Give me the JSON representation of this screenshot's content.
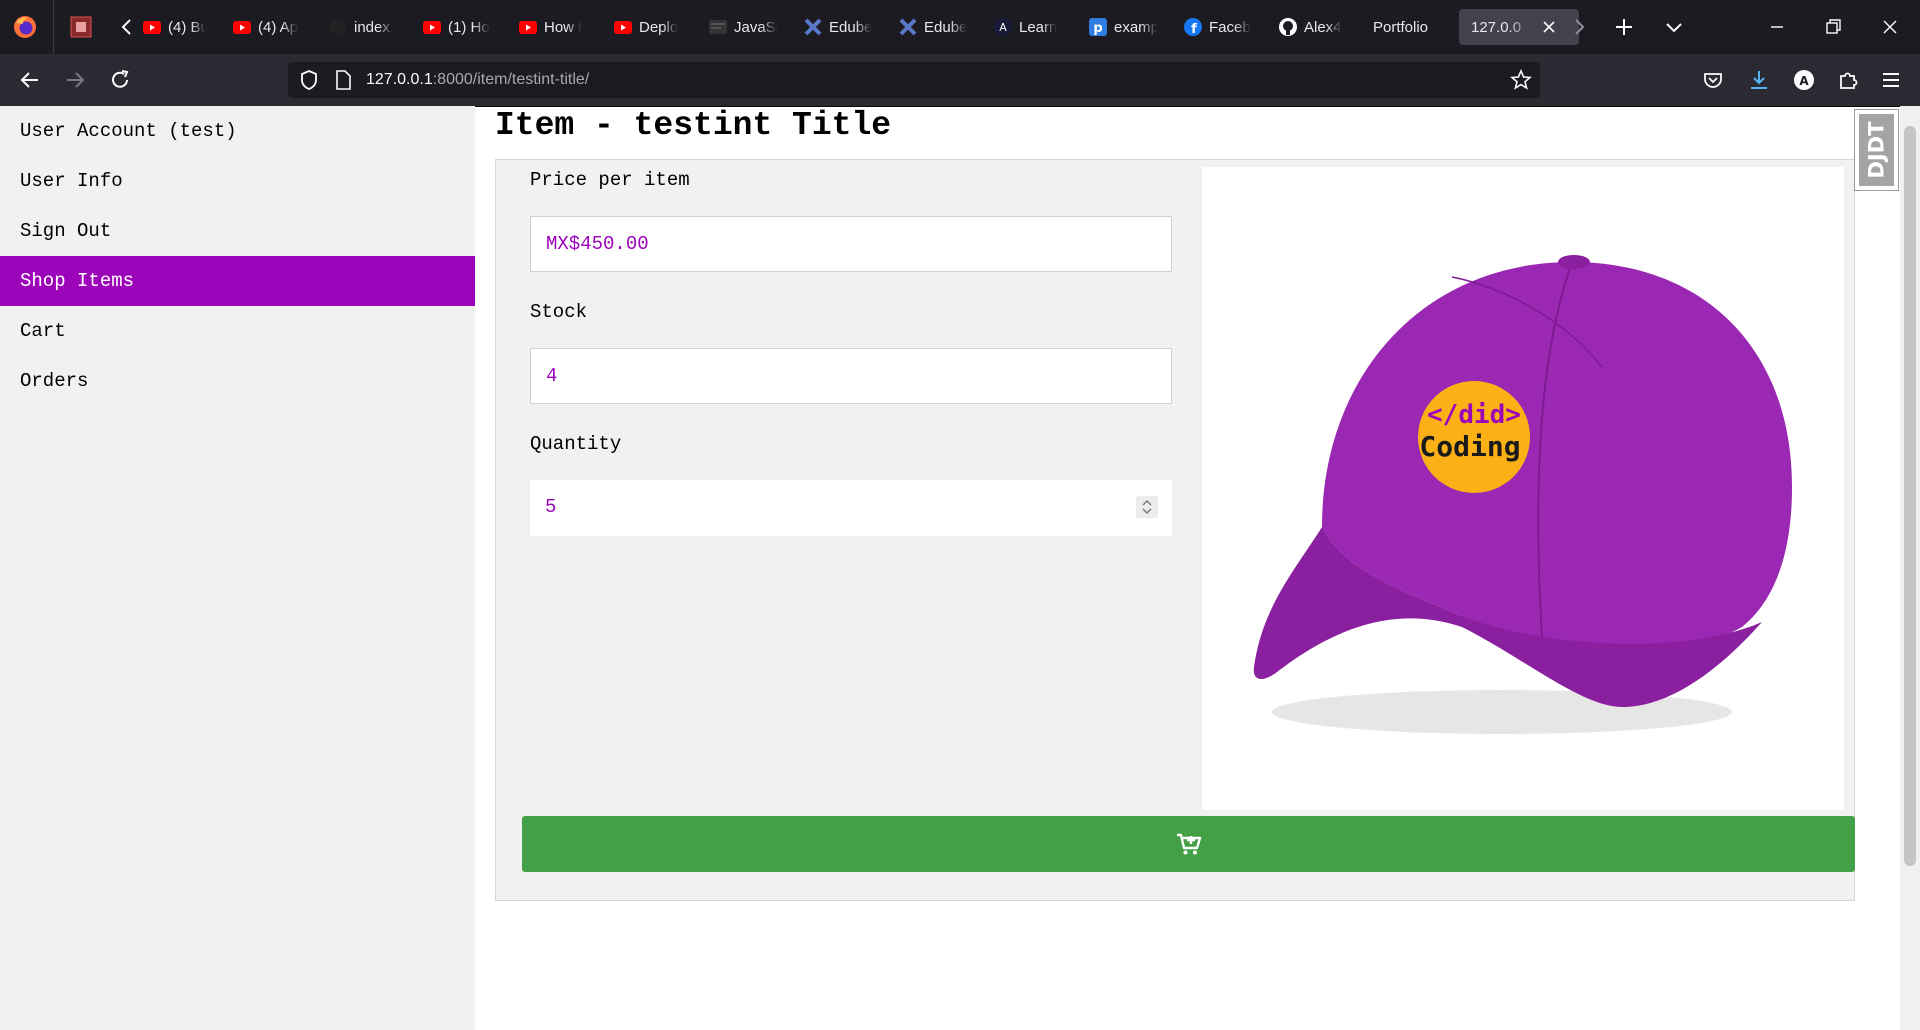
{
  "browser": {
    "tabs": [
      {
        "label": "(4) Bu",
        "icon": "youtube-icon"
      },
      {
        "label": "(4) Ap",
        "icon": "youtube-icon"
      },
      {
        "label": "index.",
        "icon": "github-icon"
      },
      {
        "label": "(1) Ho",
        "icon": "youtube-icon"
      },
      {
        "label": "How t",
        "icon": "youtube-icon"
      },
      {
        "label": "Deplo",
        "icon": "youtube-icon"
      },
      {
        "label": "JavaSc",
        "icon": "page-icon"
      },
      {
        "label": "Edube",
        "icon": "edube-icon"
      },
      {
        "label": "Edube",
        "icon": "edube-icon"
      },
      {
        "label": "Learn",
        "icon": "angular-icon"
      },
      {
        "label": "examp",
        "icon": "p-icon"
      },
      {
        "label": "Faceb",
        "icon": "facebook-icon"
      },
      {
        "label": "Alex4",
        "icon": "github-icon"
      },
      {
        "label": "Portfolio",
        "icon": "none"
      }
    ],
    "active_tab": {
      "label": "127.0.0",
      "icon": "none"
    },
    "url": {
      "host": "127.0.0.1",
      "rest": ":8000/item/testint-title/"
    }
  },
  "sidebar": {
    "items": [
      {
        "label": "User Account (test)"
      },
      {
        "label": "User Info"
      },
      {
        "label": "Sign Out"
      },
      {
        "label": "Shop Items",
        "active": true
      },
      {
        "label": "Cart"
      },
      {
        "label": "Orders"
      }
    ]
  },
  "page": {
    "title": "Item - testint Title",
    "price_label": "Price per item",
    "price_value": "MX$450.00",
    "stock_label": "Stock",
    "stock_value": "4",
    "quantity_label": "Quantity",
    "quantity_value": "5",
    "image": {
      "logo_line1": "</did>",
      "logo_line2": "Coding"
    },
    "cart_button_icon": "add-to-cart-icon"
  },
  "toolbar": {
    "djdt_label": "DJDT"
  },
  "colors": {
    "accent": "#9b04b9",
    "button": "#43a047",
    "cap": "#9b28b2",
    "logo": "#fbb115"
  }
}
